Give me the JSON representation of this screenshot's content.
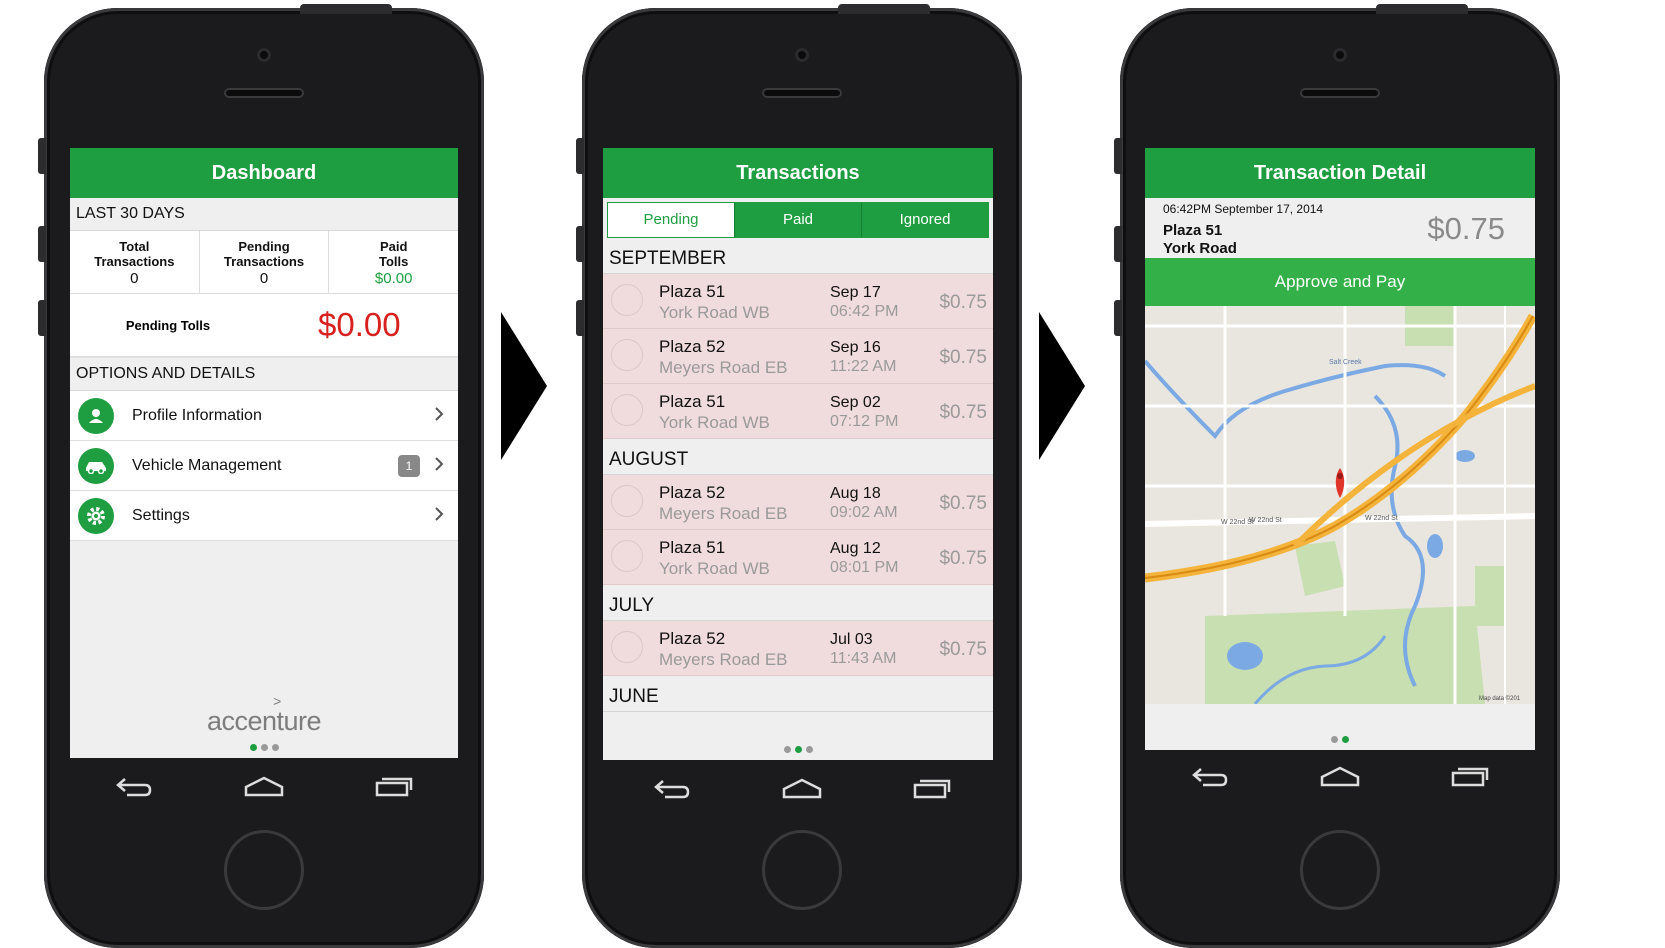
{
  "dashboard": {
    "title": "Dashboard",
    "section1": "LAST 30 DAYS",
    "stats": [
      {
        "label1": "Total",
        "label2": "Transactions",
        "value": "0"
      },
      {
        "label1": "Pending",
        "label2": "Transactions",
        "value": "0"
      },
      {
        "label1": "Paid",
        "label2": "Tolls",
        "value": "$0.00"
      }
    ],
    "pending_tolls_label": "Pending Tolls",
    "pending_tolls_value": "$0.00",
    "section2": "OPTIONS AND DETAILS",
    "options": [
      {
        "label": "Profile Information",
        "icon": "person-icon"
      },
      {
        "label": "Vehicle Management",
        "icon": "car-icon",
        "badge": "1"
      },
      {
        "label": "Settings",
        "icon": "gear-icon"
      }
    ],
    "logo_text": "accenture",
    "logo_mark": ">"
  },
  "transactions": {
    "title": "Transactions",
    "tabs": [
      "Pending",
      "Paid",
      "Ignored"
    ],
    "selected_tab": "Pending",
    "groups": [
      {
        "month": "SEPTEMBER",
        "items": [
          {
            "plaza": "Plaza 51",
            "road": "York Road WB",
            "date": "Sep 17",
            "time": "06:42 PM",
            "amount": "$0.75"
          },
          {
            "plaza": "Plaza 52",
            "road": "Meyers Road EB",
            "date": "Sep 16",
            "time": "11:22 AM",
            "amount": "$0.75"
          },
          {
            "plaza": "Plaza 51",
            "road": "York Road WB",
            "date": "Sep 02",
            "time": "07:12 PM",
            "amount": "$0.75"
          }
        ]
      },
      {
        "month": "AUGUST",
        "items": [
          {
            "plaza": "Plaza 52",
            "road": "Meyers Road EB",
            "date": "Aug 18",
            "time": "09:02 AM",
            "amount": "$0.75"
          },
          {
            "plaza": "Plaza 51",
            "road": "York Road WB",
            "date": "Aug 12",
            "time": "08:01 PM",
            "amount": "$0.75"
          }
        ]
      },
      {
        "month": "JULY",
        "items": [
          {
            "plaza": "Plaza 52",
            "road": "Meyers Road EB",
            "date": "Jul 03",
            "time": "11:43 AM",
            "amount": "$0.75"
          }
        ]
      },
      {
        "month": "JUNE",
        "items": []
      }
    ]
  },
  "detail": {
    "title": "Transaction Detail",
    "timestamp": "06:42PM September 17, 2014",
    "plaza": "Plaza 51",
    "road": "York Road",
    "amount": "$0.75",
    "approve_label": "Approve and Pay",
    "map_labels": [
      "Salt Creek",
      "W 22nd St",
      "W 22nd St",
      "W 22nd St",
      "Map data ©201"
    ]
  },
  "pager": {
    "dashboard_active": 1,
    "transactions_active": 2,
    "detail_active": 2
  },
  "colors": {
    "brand_green": "#1e9e40",
    "pending_red": "#d8201e",
    "row_pink": "#f0dcdc"
  }
}
